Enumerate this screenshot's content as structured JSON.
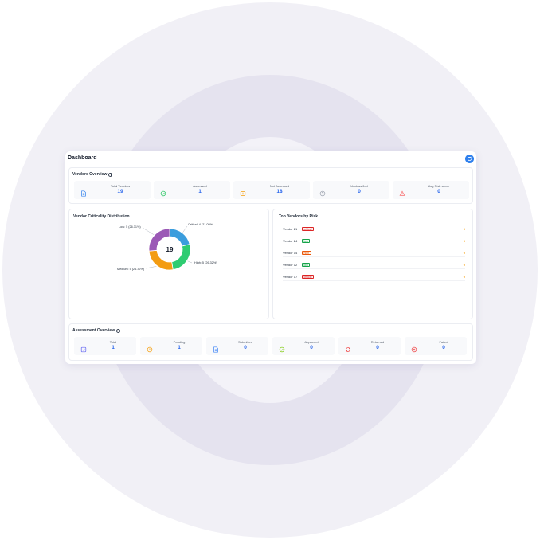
{
  "dashboard": {
    "title": "Dashboard"
  },
  "vendors_overview": {
    "title": "Vendors Overview",
    "stats": [
      {
        "label": "Total Vendors",
        "value": "19",
        "icon": "document-icon",
        "color": "#2f80ed"
      },
      {
        "label": "Assessed",
        "value": "1",
        "icon": "check-circle-icon",
        "color": "#22c55e"
      },
      {
        "label": "Not Assessed",
        "value": "18",
        "icon": "warning-box-icon",
        "color": "#f59e0b"
      },
      {
        "label": "Unclassified",
        "value": "0",
        "icon": "question-circle-icon",
        "color": "#9ca3af"
      },
      {
        "label": "Avg Risk score",
        "value": "0",
        "icon": "alert-icon",
        "color": "#f87171"
      }
    ]
  },
  "criticality": {
    "title": "Vendor Criticality Distribution",
    "center_value": "19",
    "callouts": {
      "critical": "Critical: 4 (21.05%)",
      "high": "High: 5 (26.32%)",
      "medium": "Medium: 5 (26.32%)",
      "low": "Low: 5 (26.31%)"
    }
  },
  "chart_data": {
    "type": "pie",
    "title": "Vendor Criticality Distribution",
    "categories": [
      "Critical",
      "High",
      "Medium",
      "Low"
    ],
    "values": [
      4,
      5,
      5,
      5
    ],
    "colors": [
      "#3b9ddd",
      "#2ecc71",
      "#f39c12",
      "#9b59b6"
    ],
    "total": 19
  },
  "top_vendors": {
    "title": "Top Vendors by Risk",
    "rows": [
      {
        "name": "Vendor 21",
        "level": "critical",
        "score": "0"
      },
      {
        "name": "Vendor 24",
        "level": "low",
        "score": "0"
      },
      {
        "name": "Vendor 14",
        "level": "high",
        "score": "0"
      },
      {
        "name": "Vendor 12",
        "level": "low",
        "score": "0"
      },
      {
        "name": "Vendor 17",
        "level": "critical",
        "score": "0"
      }
    ]
  },
  "assessment_overview": {
    "title": "Assessment Overview",
    "stats": [
      {
        "label": "Total",
        "value": "1",
        "icon": "checklist-icon",
        "color": "#6366f1"
      },
      {
        "label": "Pending",
        "value": "1",
        "icon": "clock-icon",
        "color": "#f59e0b"
      },
      {
        "label": "Submitted",
        "value": "0",
        "icon": "file-icon",
        "color": "#3b82f6"
      },
      {
        "label": "Approved",
        "value": "0",
        "icon": "check-circle-icon",
        "color": "#84cc16"
      },
      {
        "label": "Returned",
        "value": "0",
        "icon": "sync-icon",
        "color": "#ef4444"
      },
      {
        "label": "Failed",
        "value": "0",
        "icon": "close-circle-icon",
        "color": "#ef4444"
      }
    ]
  }
}
